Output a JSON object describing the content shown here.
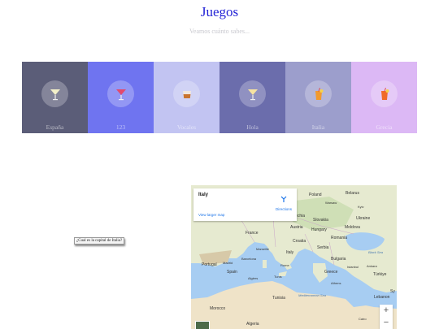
{
  "header": {
    "title": "Juegos",
    "subtitle": "Veamos cuánto sabes..."
  },
  "categories": [
    {
      "label": "España",
      "color": "#5b5d78",
      "icon": "cocktail-glass-icon"
    },
    {
      "label": "123",
      "color": "#6f74f0",
      "icon": "cocktail-red-icon"
    },
    {
      "label": "Vocales",
      "color": "#c2c4f2",
      "icon": "tumbler-glass-icon"
    },
    {
      "label": "Hola",
      "color": "#6b6dac",
      "icon": "cocktail-glass-icon"
    },
    {
      "label": "Italia",
      "color": "#9c9ecc",
      "icon": "tropical-drink-icon"
    },
    {
      "label": "Grecia",
      "color": "#dcb8f5",
      "icon": "tropical-drink-icon"
    }
  ],
  "question": "¿Cual es la capital de Italia?",
  "map": {
    "place": "Italy",
    "directions": "Directions",
    "view_larger": "View larger map",
    "zoom_in": "+",
    "zoom_out": "−",
    "labels": {
      "poland": "Poland",
      "belarus": "Belarus",
      "warsaw": "Warsaw",
      "kyiv": "Kyiv",
      "czechia": "Czechia",
      "slovakia": "Slovakia",
      "ukraine": "Ukraine",
      "austria": "Austria",
      "hungary": "Hungary",
      "moldova": "Moldova",
      "france": "France",
      "romania": "Romania",
      "croatia": "Croatia",
      "serbia": "Serbia",
      "marseille": "Marseille",
      "italy": "Italy",
      "black_sea": "Black Sea",
      "bulgaria": "Bulgaria",
      "portugal": "Portugal",
      "madrid": "Madrid",
      "spain": "Spain",
      "barcelona": "Barcelona",
      "rome": "Rome",
      "istanbul": "Istanbul",
      "ankara": "Ankara",
      "greece": "Greece",
      "turkiye": "Türkiye",
      "algiers": "Algiers",
      "tunis": "Tunis",
      "athens": "Athens",
      "tunisia": "Tunisia",
      "mediterranean": "Mediterranean Sea",
      "syria": "Sy",
      "lebanon": "Lebanon",
      "morocco": "Morocco",
      "algeria": "Algeria",
      "cairo": "Cairo"
    }
  }
}
